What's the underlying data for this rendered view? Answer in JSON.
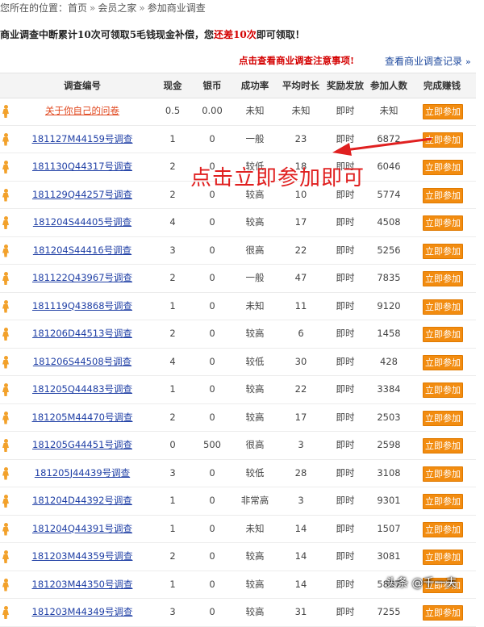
{
  "breadcrumb": {
    "prefix": "您所在的位置：",
    "items": [
      "首页",
      "会员之家",
      "参加商业调查"
    ],
    "separator": "»"
  },
  "notice": {
    "text_before": "商业调查中断累计10次可领取5毛钱现金补偿，您",
    "highlight": "还差10次",
    "text_after": "即可领取！"
  },
  "links": {
    "attention": "点击查看商业调查注意事项!",
    "records": "查看商业调查记录",
    "records_arrow": "»"
  },
  "table": {
    "headers": [
      "调查编号",
      "现金",
      "银币",
      "成功率",
      "平均时长",
      "奖励发放",
      "参加人数",
      "完成赚钱"
    ],
    "button_label": "立即参加",
    "rows": [
      {
        "id": "关于你自己的问卷",
        "cash": "0.5",
        "silver": "0.00",
        "rate": "未知",
        "avg": "未知",
        "reward": "即时",
        "people": "未知"
      },
      {
        "id": "181127M44159号调查",
        "cash": "1",
        "silver": "0",
        "rate": "一般",
        "avg": "23",
        "reward": "即时",
        "people": "6872"
      },
      {
        "id": "181130Q44317号调查",
        "cash": "2",
        "silver": "0",
        "rate": "较低",
        "avg": "18",
        "reward": "即时",
        "people": "6046"
      },
      {
        "id": "181129Q44257号调查",
        "cash": "2",
        "silver": "0",
        "rate": "较高",
        "avg": "10",
        "reward": "即时",
        "people": "5774"
      },
      {
        "id": "181204S44405号调查",
        "cash": "4",
        "silver": "0",
        "rate": "较高",
        "avg": "17",
        "reward": "即时",
        "people": "4508"
      },
      {
        "id": "181204S44416号调查",
        "cash": "3",
        "silver": "0",
        "rate": "很高",
        "avg": "22",
        "reward": "即时",
        "people": "5256"
      },
      {
        "id": "181122Q43967号调查",
        "cash": "2",
        "silver": "0",
        "rate": "一般",
        "avg": "47",
        "reward": "即时",
        "people": "7835"
      },
      {
        "id": "181119Q43868号调查",
        "cash": "1",
        "silver": "0",
        "rate": "未知",
        "avg": "11",
        "reward": "即时",
        "people": "9120"
      },
      {
        "id": "181206D44513号调查",
        "cash": "2",
        "silver": "0",
        "rate": "较高",
        "avg": "6",
        "reward": "即时",
        "people": "1458"
      },
      {
        "id": "181206S44508号调查",
        "cash": "4",
        "silver": "0",
        "rate": "较低",
        "avg": "30",
        "reward": "即时",
        "people": "428"
      },
      {
        "id": "181205Q44483号调查",
        "cash": "1",
        "silver": "0",
        "rate": "较高",
        "avg": "22",
        "reward": "即时",
        "people": "3384"
      },
      {
        "id": "181205M44470号调查",
        "cash": "2",
        "silver": "0",
        "rate": "较高",
        "avg": "17",
        "reward": "即时",
        "people": "2503"
      },
      {
        "id": "181205G44451号调查",
        "cash": "0",
        "silver": "500",
        "rate": "很高",
        "avg": "3",
        "reward": "即时",
        "people": "2598"
      },
      {
        "id": "181205J44439号调查",
        "cash": "3",
        "silver": "0",
        "rate": "较低",
        "avg": "28",
        "reward": "即时",
        "people": "3108"
      },
      {
        "id": "181204D44392号调查",
        "cash": "1",
        "silver": "0",
        "rate": "非常高",
        "avg": "3",
        "reward": "即时",
        "people": "9301"
      },
      {
        "id": "181204Q44391号调查",
        "cash": "1",
        "silver": "0",
        "rate": "未知",
        "avg": "14",
        "reward": "即时",
        "people": "1507"
      },
      {
        "id": "181203M44359号调查",
        "cash": "2",
        "silver": "0",
        "rate": "较高",
        "avg": "14",
        "reward": "即时",
        "people": "3081"
      },
      {
        "id": "181203M44350号调查",
        "cash": "1",
        "silver": "0",
        "rate": "较高",
        "avg": "14",
        "reward": "即时",
        "people": "5887"
      },
      {
        "id": "181203M44349号调查",
        "cash": "3",
        "silver": "0",
        "rate": "较高",
        "avg": "31",
        "reward": "即时",
        "people": "7255"
      }
    ]
  },
  "annotation": {
    "text": "点击立即参加即可",
    "color": "#e02020"
  },
  "watermark": "头条 @千一夫",
  "colors": {
    "button": "#f28c10",
    "link": "#1f3fa5",
    "highlight": "#d40000",
    "person_icon": "#f2a12b"
  },
  "icons": {
    "row_icon": "person-icon"
  }
}
